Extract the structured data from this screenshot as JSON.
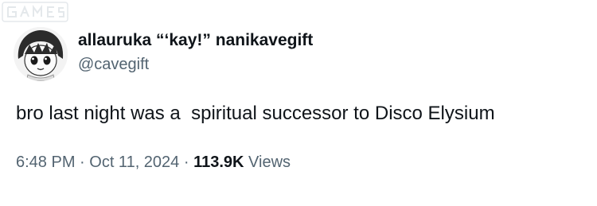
{
  "watermark": {
    "text": "GAMES"
  },
  "author": {
    "display_name": "allauruka “‘kay!” nanikavegift",
    "handle": "@cavegift"
  },
  "tweet": {
    "text": "bro last night was a  spiritual successor to Disco Elysium"
  },
  "meta": {
    "time": "6:48 PM",
    "sep1": " · ",
    "date": "Oct 11, 2024",
    "sep2": " · ",
    "views_count": "113.9K",
    "views_label": " Views"
  },
  "colors": {
    "text_primary": "#0f1419",
    "text_secondary": "#536471",
    "background": "#ffffff"
  },
  "icons": {
    "avatar": "anime-character-avatar",
    "watermark": "site-watermark-logo"
  }
}
